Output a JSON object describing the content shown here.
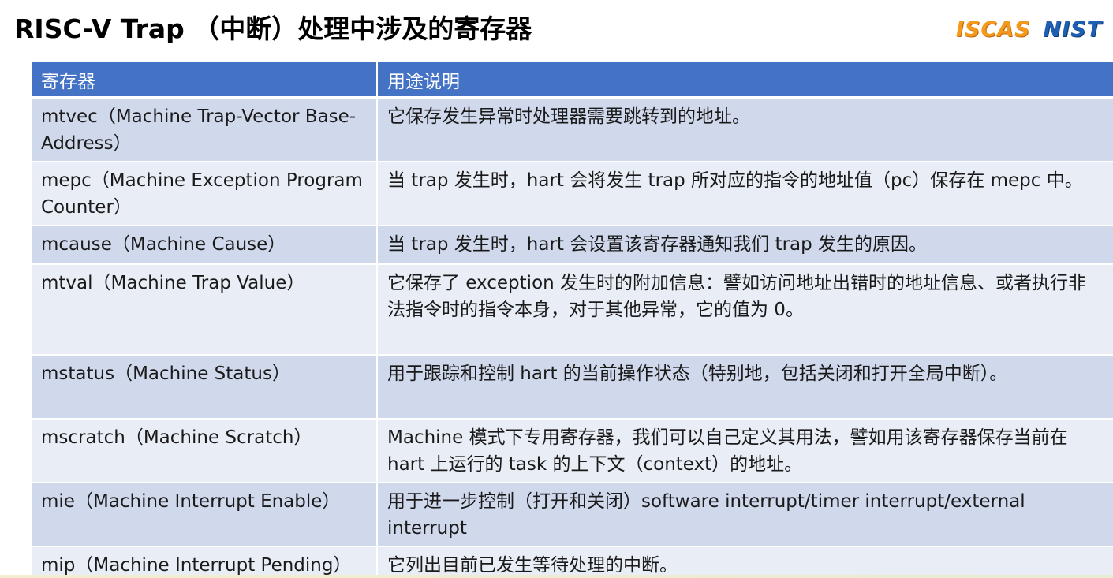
{
  "slide": {
    "title": "RISC-V Trap （中断）处理中涉及的寄存器",
    "logos": [
      "ISCAS",
      "NIST"
    ]
  },
  "table": {
    "headers": [
      "寄存器",
      "用途说明"
    ],
    "rows": [
      {
        "register": "mtvec（Machine Trap-Vector Base-Address）",
        "description": "它保存发生异常时处理器需要跳转到的地址。"
      },
      {
        "register": "mepc（Machine Exception Program Counter）",
        "description": "当 trap 发生时，hart 会将发生 trap 所对应的指令的地址值（pc）保存在 mepc 中。"
      },
      {
        "register": "mcause（Machine Cause）",
        "description": "当 trap 发生时，hart 会设置该寄存器通知我们 trap 发生的原因。"
      },
      {
        "register": "mtval（Machine Trap Value）",
        "description": "它保存了 exception 发生时的附加信息：譬如访问地址出错时的地址信息、或者执行非法指令时的指令本身，对于其他异常，它的值为 0。"
      },
      {
        "register": "mstatus（Machine Status）",
        "description": "用于跟踪和控制 hart 的当前操作状态（特别地，包括关闭和打开全局中断）。"
      },
      {
        "register": "mscratch（Machine Scratch）",
        "description": "Machine 模式下专用寄存器，我们可以自己定义其用法，譬如用该寄存器保存当前在 hart 上运行的 task 的上下文（context）的地址。"
      },
      {
        "register": "mie（Machine Interrupt Enable）",
        "description": "用于进一步控制（打开和关闭）software interrupt/timer interrupt/external interrupt"
      },
      {
        "register": "mip（Machine Interrupt Pending）",
        "description": "它列出目前已发生等待处理的中断。"
      }
    ]
  },
  "colors": {
    "header_bg": "#4472c4",
    "row_odd_bg": "#d0d8ec",
    "row_even_bg": "#e9edf6",
    "iscas_logo": "#f39a1c",
    "nist_logo": "#1f5fb3"
  }
}
